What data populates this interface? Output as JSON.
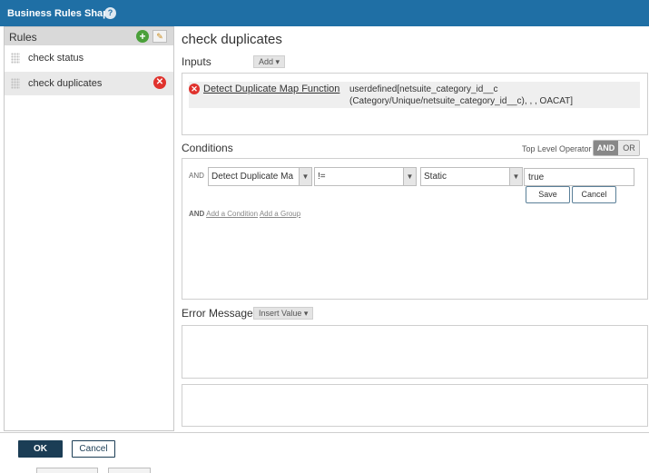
{
  "window": {
    "title": "Business Rules Shape",
    "help_icon": "?"
  },
  "sidebar": {
    "header": "Rules",
    "add_icon": "+",
    "edit_icon": "✎",
    "items": [
      {
        "label": "check status",
        "selected": false
      },
      {
        "label": "check duplicates",
        "selected": true,
        "delete_icon": "✕"
      }
    ]
  },
  "main": {
    "title": "check duplicates",
    "inputs": {
      "label": "Inputs",
      "add_label": "Add ▾",
      "items": [
        {
          "error_icon": "✕",
          "name": "Detect Duplicate Map Function",
          "value": "userdefined[netsuite_category_id__c (Category/Unique/netsuite_category_id__c), , , OACAT]"
        }
      ]
    },
    "conditions": {
      "label": "Conditions",
      "top_level_operator_label": "Top Level Operator",
      "operator_and": "AND",
      "operator_or": "OR",
      "selected_operator": "AND",
      "row": {
        "prefix": "AND",
        "field": "Detect Duplicate Ma",
        "operator": "!=",
        "type": "Static",
        "value": "true",
        "save_label": "Save",
        "cancel_label": "Cancel"
      },
      "add_prefix": "AND",
      "add_condition": "Add a Condition",
      "add_group": "Add a Group"
    },
    "error_message": {
      "label": "Error Message",
      "insert_value_label": "Insert Value ▾"
    }
  },
  "footer": {
    "ok_label": "OK",
    "cancel_label": "Cancel"
  },
  "colors": {
    "titlebar": "#1f6fa5",
    "primary_button": "#1b3d55",
    "error": "#e0322d",
    "add": "#4aa03a"
  }
}
